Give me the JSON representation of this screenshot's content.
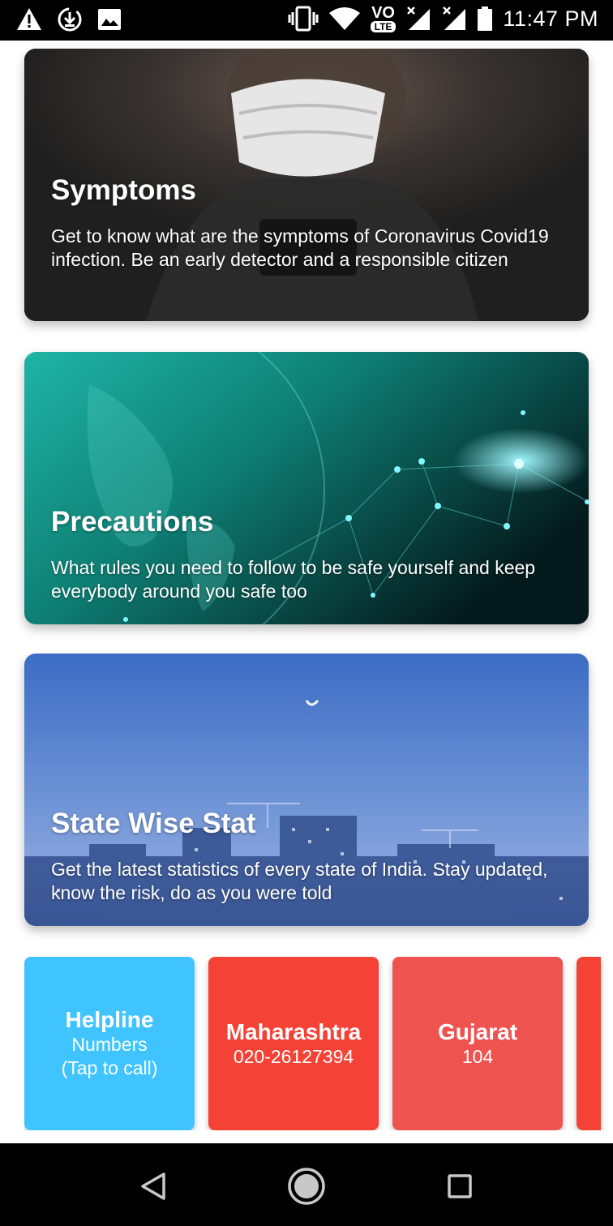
{
  "status_bar": {
    "time": "11:47 PM",
    "network_badge_top": "VO",
    "network_badge_bottom": "LTE",
    "icons_left": [
      "warning-icon",
      "download-icon",
      "image-icon"
    ],
    "icons_right": [
      "vibrate-icon",
      "wifi-icon",
      "volte-icon",
      "signal-icon",
      "signal-icon",
      "battery-icon"
    ]
  },
  "cards": {
    "symptoms": {
      "title": "Symptoms",
      "description": "Get to know what are the symptoms of Coronavirus Covid19 infection. Be an early detector and a responsible citizen"
    },
    "precautions": {
      "title": "Precautions",
      "description": "What rules you need to follow to be safe yourself and keep everybody around you safe too"
    },
    "state_stat": {
      "title": "State Wise Stat",
      "description": "Get the latest statistics of every state of India. Stay updated, know the risk, do as you were told"
    }
  },
  "helplines": {
    "main": {
      "title": "Helpline",
      "line1": "Numbers",
      "line2": "(Tap to call)",
      "color": "#40c4ff"
    },
    "maharashtra": {
      "title": "Maharashtra",
      "number": "020-26127394",
      "color": "#f44336"
    },
    "gujarat": {
      "title": "Gujarat",
      "number": "104",
      "color": "#ef5350"
    }
  },
  "nav_bar": {
    "icons": [
      "back-icon",
      "home-icon",
      "recents-icon"
    ]
  }
}
